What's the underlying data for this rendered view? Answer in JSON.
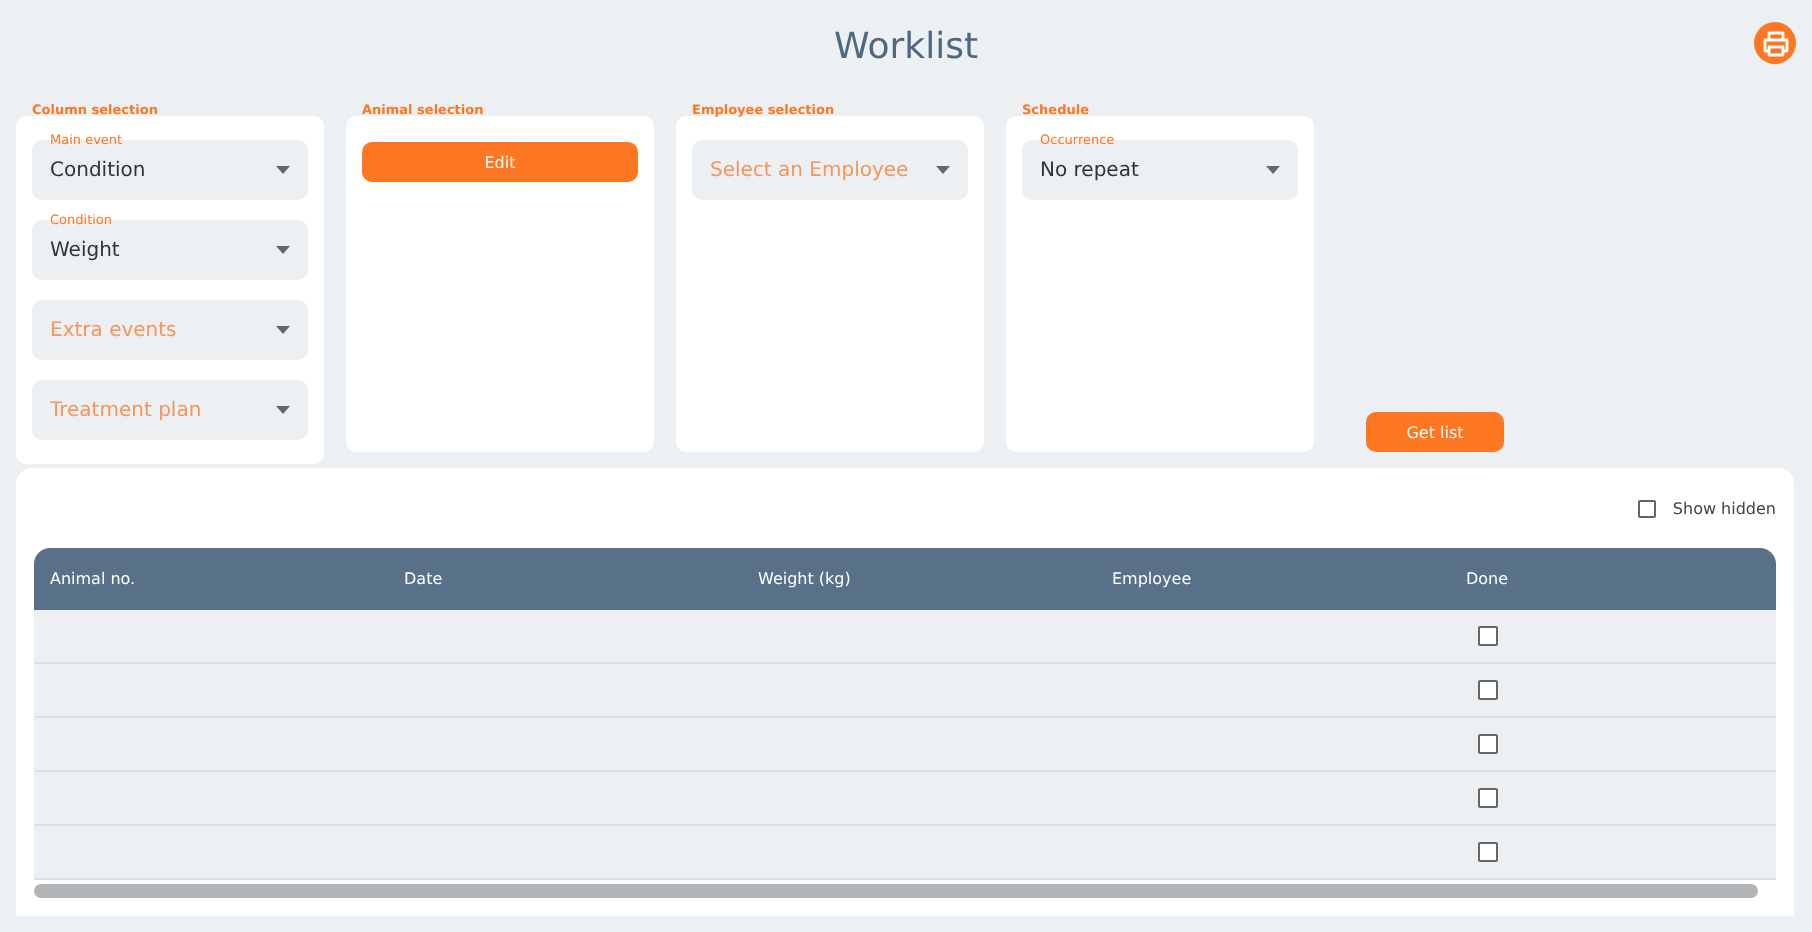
{
  "title": "Worklist",
  "sections": [
    {
      "heading": "Column selection",
      "kind": "selects",
      "fields": [
        {
          "label": "Main event",
          "value": "Condition"
        },
        {
          "label": "Condition",
          "value": "Weight"
        },
        {
          "placeholder": "Extra events"
        },
        {
          "placeholder": "Treatment plan"
        }
      ]
    },
    {
      "heading": "Animal selection",
      "kind": "button",
      "button": "Edit"
    },
    {
      "heading": "Employee selection",
      "kind": "selects",
      "fields": [
        {
          "placeholder": "Select an Employee"
        }
      ]
    },
    {
      "heading": "Schedule",
      "kind": "selects",
      "fields": [
        {
          "label": "Occurrence",
          "value": "No repeat"
        }
      ]
    }
  ],
  "get_list_button": "Get list",
  "show_hidden": {
    "label": "Show hidden",
    "checked": false
  },
  "table": {
    "columns": [
      "Animal no.",
      "Date",
      "Weight (kg)",
      "Employee",
      "Done"
    ],
    "rows": [
      {
        "done": false
      },
      {
        "done": false
      },
      {
        "done": false
      },
      {
        "done": false
      },
      {
        "done": false
      }
    ]
  }
}
